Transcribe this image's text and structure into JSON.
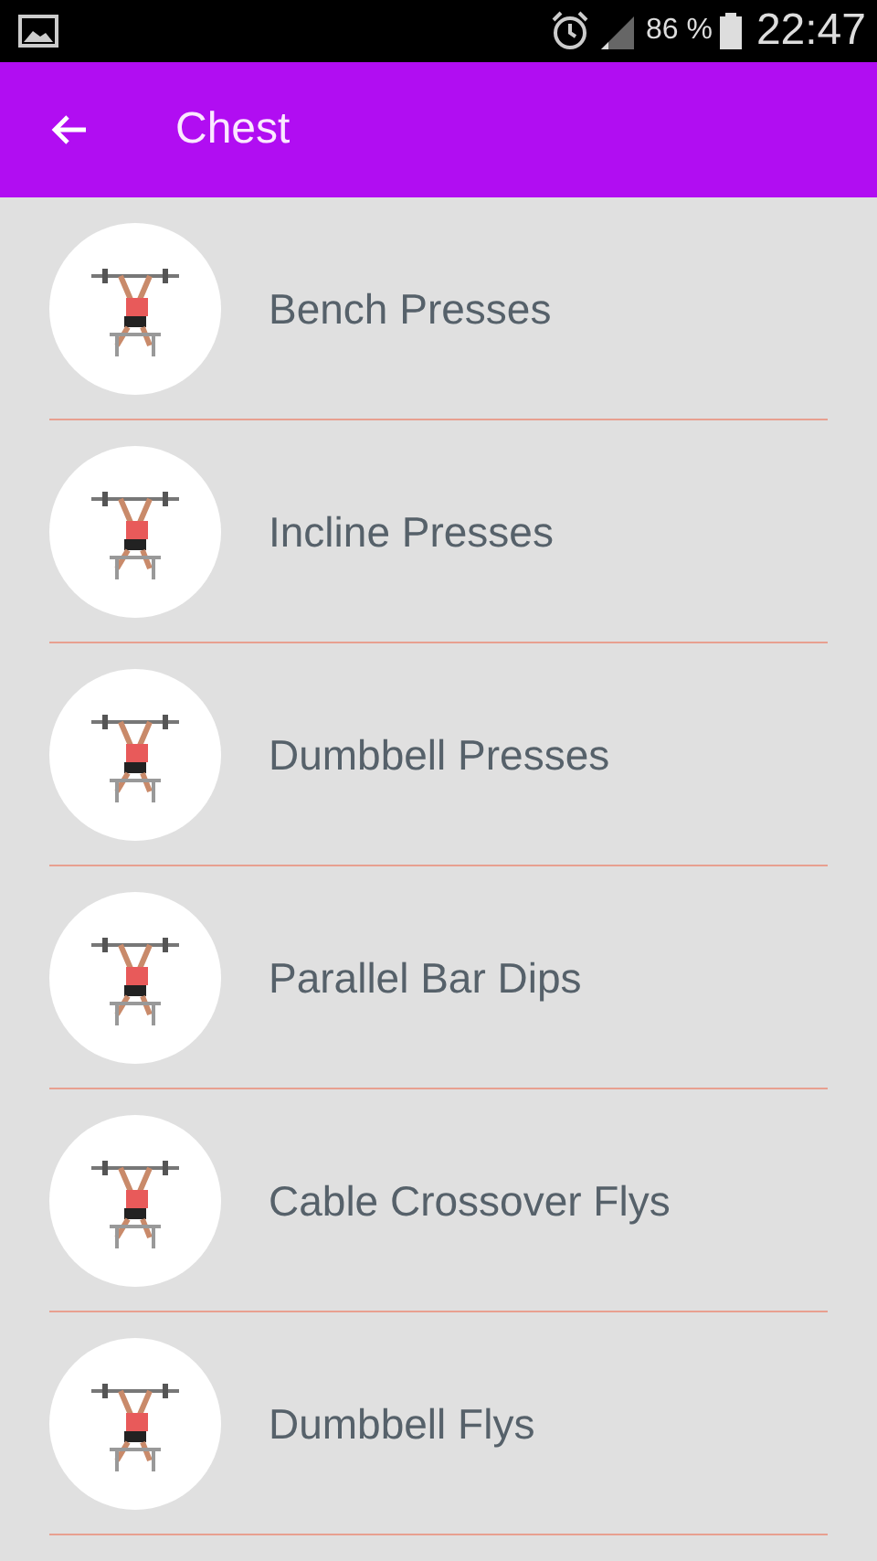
{
  "status_bar": {
    "battery_percent": "86 %",
    "time": "22:47"
  },
  "app_bar": {
    "title": "Chest"
  },
  "exercises": [
    {
      "name": "Bench Presses"
    },
    {
      "name": "Incline Presses"
    },
    {
      "name": "Dumbbell Presses"
    },
    {
      "name": "Parallel Bar Dips"
    },
    {
      "name": "Cable Crossover Flys"
    },
    {
      "name": "Dumbbell Flys"
    }
  ]
}
